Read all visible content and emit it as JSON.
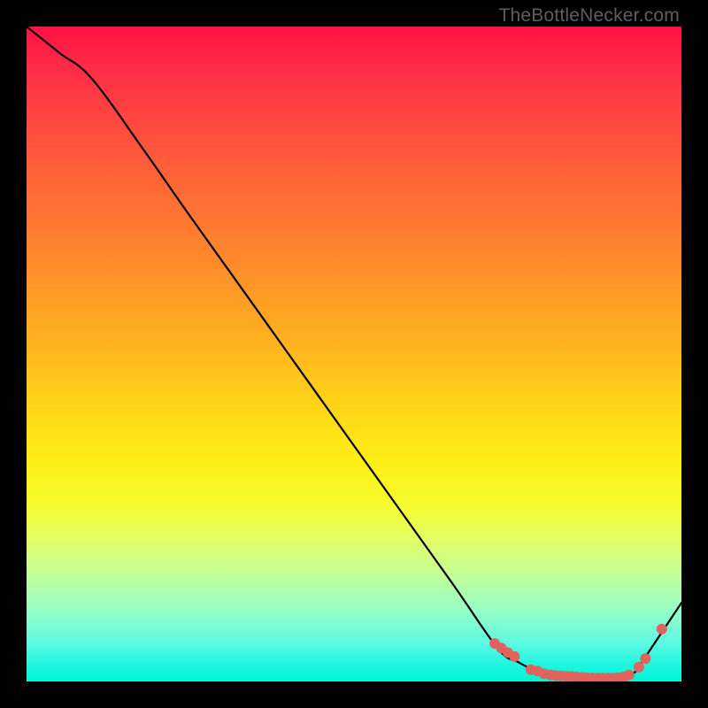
{
  "attribution": "TheBottleNecker.com",
  "chart_data": {
    "type": "line",
    "title": "",
    "xlabel": "",
    "ylabel": "",
    "xlim": [
      0,
      100
    ],
    "ylim": [
      0,
      100
    ],
    "grid": false,
    "series": [
      {
        "name": "curve",
        "x": [
          0,
          5,
          10,
          18,
          25,
          35,
          45,
          55,
          65,
          72,
          75,
          78,
          80,
          82,
          84,
          85,
          87,
          89,
          91,
          93,
          94,
          96,
          100
        ],
        "y": [
          100,
          96,
          92,
          81,
          71,
          57,
          43,
          29,
          15,
          5,
          3,
          1.5,
          1,
          0.8,
          0.7,
          0.5,
          0.5,
          0.5,
          0.5,
          1.5,
          3,
          6,
          12
        ]
      }
    ],
    "markers": {
      "name": "highlight-points",
      "color": "#e0635e",
      "x": [
        71.5,
        72.5,
        73.5,
        74.5,
        77,
        78,
        79,
        80,
        80.8,
        81.6,
        82.4,
        83.2,
        84,
        84.8,
        85.6,
        86.4,
        87.2,
        88,
        88.8,
        89.6,
        90.4,
        91.2,
        92,
        93.5,
        94.5,
        97
      ],
      "y": [
        5.8,
        5.1,
        4.4,
        3.8,
        1.8,
        1.6,
        1.2,
        1.0,
        0.9,
        0.85,
        0.8,
        0.75,
        0.7,
        0.6,
        0.55,
        0.5,
        0.5,
        0.5,
        0.5,
        0.5,
        0.55,
        0.7,
        1.0,
        2.2,
        3.5,
        8.0
      ]
    },
    "gradient_stops": [
      {
        "offset": 0,
        "color": "#ff1243"
      },
      {
        "offset": 50,
        "color": "#ffd517"
      },
      {
        "offset": 75,
        "color": "#e5fd62"
      },
      {
        "offset": 100,
        "color": "#00f5d4"
      }
    ]
  }
}
